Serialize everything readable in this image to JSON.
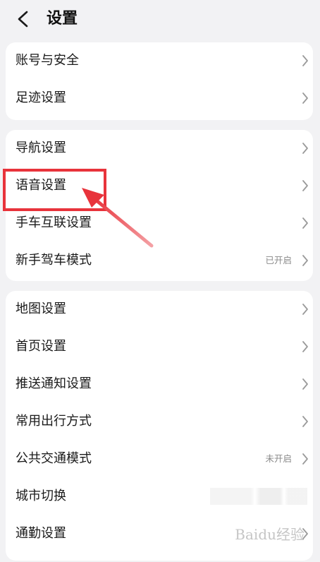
{
  "header": {
    "title": "设置",
    "back_icon": "chevron-left-icon"
  },
  "cards": [
    {
      "items": [
        {
          "label": "账号与安全",
          "value": ""
        },
        {
          "label": "足迹设置",
          "value": ""
        }
      ]
    },
    {
      "items": [
        {
          "label": "导航设置",
          "value": ""
        },
        {
          "label": "语音设置",
          "value": ""
        },
        {
          "label": "手车互联设置",
          "value": ""
        },
        {
          "label": "新手驾车模式",
          "value": "已开启"
        }
      ]
    },
    {
      "items": [
        {
          "label": "地图设置",
          "value": ""
        },
        {
          "label": "首页设置",
          "value": ""
        },
        {
          "label": "推送通知设置",
          "value": ""
        },
        {
          "label": "常用出行方式",
          "value": ""
        },
        {
          "label": "公共交通模式",
          "value": "未开启"
        },
        {
          "label": "城市切换",
          "value": ""
        },
        {
          "label": "通勤设置",
          "value": ""
        }
      ]
    }
  ],
  "annotation": {
    "highlight_color": "#e8333b",
    "highlighted_item": "语音设置"
  },
  "watermark": {
    "text": "Baidu经验"
  },
  "colors": {
    "background": "#f2f2f4",
    "card": "#ffffff",
    "text": "#1a1a1a",
    "secondary": "#8a8a8a",
    "chevron": "#9a9a9a"
  }
}
